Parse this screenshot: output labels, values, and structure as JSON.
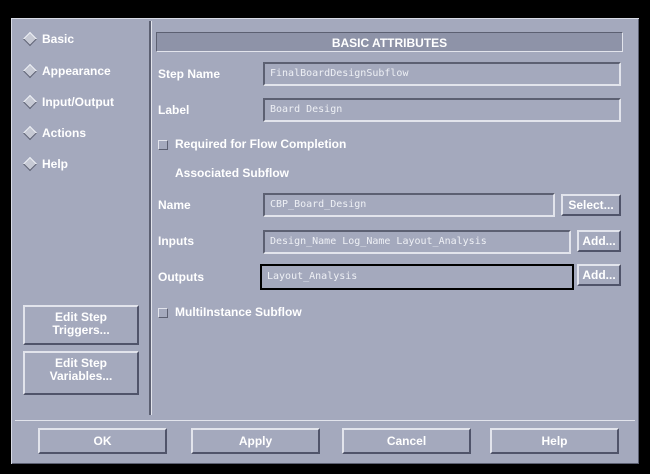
{
  "sidebar": {
    "items": [
      {
        "label": "Basic"
      },
      {
        "label": "Appearance"
      },
      {
        "label": "Input/Output"
      },
      {
        "label": "Actions"
      },
      {
        "label": "Help"
      }
    ],
    "edit_triggers_label": "Edit Step\nTriggers...",
    "edit_variables_label": "Edit Step\nVariables..."
  },
  "header": {
    "title": "BASIC ATTRIBUTES"
  },
  "form": {
    "step_name_label": "Step Name",
    "step_name_value": "FinalBoardDesignSubflow",
    "label_label": "Label",
    "label_value": "Board Design",
    "required_label": "Required for Flow Completion",
    "required_checked": false,
    "associated_subflow_heading": "Associated Subflow",
    "name_label": "Name",
    "name_value": "CBP_Board_Design",
    "select_button": "Select...",
    "inputs_label": "Inputs",
    "inputs_value": "Design_Name  Log_Name  Layout_Analysis",
    "inputs_add": "Add...",
    "outputs_label": "Outputs",
    "outputs_value": "Layout_Analysis",
    "outputs_add": "Add...",
    "multiinstance_label": "MultiInstance Subflow",
    "multiinstance_checked": false
  },
  "footer": {
    "ok": "OK",
    "apply": "Apply",
    "cancel": "Cancel",
    "help": "Help"
  }
}
